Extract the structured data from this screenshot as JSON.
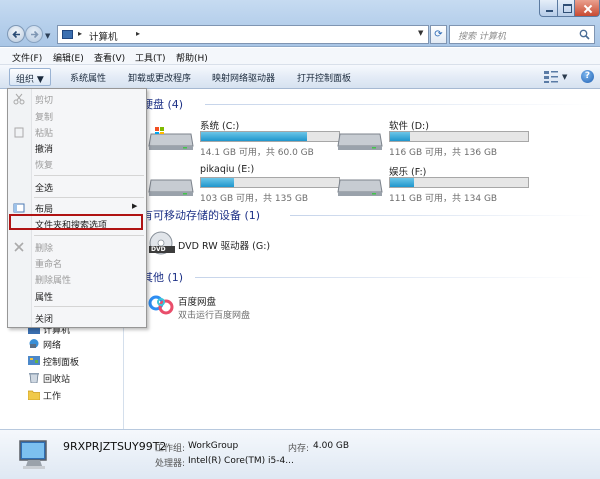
{
  "window": {
    "address": "计算机",
    "search_placeholder": "搜索 计算机"
  },
  "menubar": [
    {
      "label": "文件(F)"
    },
    {
      "label": "编辑(E)"
    },
    {
      "label": "查看(V)"
    },
    {
      "label": "工具(T)"
    },
    {
      "label": "帮助(H)"
    }
  ],
  "toolbar": {
    "organize": "组织 ▼",
    "items": [
      "系统属性",
      "卸载或更改程序",
      "映射网络驱动器",
      "打开控制面板"
    ]
  },
  "context_menu": {
    "items": [
      {
        "label": "剪切",
        "disabled": true,
        "icon": "scissors-icon"
      },
      {
        "label": "复制",
        "disabled": true,
        "icon": "copy-icon"
      },
      {
        "label": "粘贴",
        "disabled": true,
        "icon": "paste-icon"
      },
      {
        "label": "撤消",
        "disabled": false
      },
      {
        "label": "恢复",
        "disabled": true
      },
      {
        "label": "全选",
        "disabled": false
      },
      {
        "label": "布局",
        "disabled": false,
        "icon": "layout-icon",
        "submenu": true
      },
      {
        "label": "文件夹和搜索选项",
        "disabled": false,
        "highlighted": true
      },
      {
        "label": "删除",
        "disabled": true,
        "icon": "delete-icon"
      },
      {
        "label": "重命名",
        "disabled": true
      },
      {
        "label": "删除属性",
        "disabled": true
      },
      {
        "label": "属性",
        "disabled": false
      },
      {
        "label": "关闭",
        "disabled": false
      }
    ]
  },
  "nav_pane": {
    "partial_item": "计算机",
    "items": [
      {
        "label": "网络",
        "icon": "network-icon"
      },
      {
        "label": "控制面板",
        "icon": "control-panel-icon"
      },
      {
        "label": "回收站",
        "icon": "recycle-bin-icon"
      },
      {
        "label": "工作",
        "icon": "folder-icon"
      }
    ]
  },
  "groups": {
    "hard_disks": "硬盘 (4)",
    "removable": "有可移动存储的设备 (1)",
    "other": "其他 (1)"
  },
  "drives": [
    {
      "name": "系统 (C:)",
      "free_text": "14.1 GB 可用，共 60.0 GB",
      "used_fraction": 0.765
    },
    {
      "name": "软件 (D:)",
      "free_text": "116 GB 可用，共 136 GB",
      "used_fraction": 0.147
    },
    {
      "name": "pikaqiu (E:)",
      "free_text": "103 GB 可用，共 135 GB",
      "used_fraction": 0.237
    },
    {
      "name": "娱乐 (F:)",
      "free_text": "111 GB 可用，共 134 GB",
      "used_fraction": 0.172
    }
  ],
  "dvd": {
    "name": "DVD RW 驱动器 (G:)",
    "badge": "DVD"
  },
  "other_item": {
    "name": "百度网盘",
    "subtitle": "双击运行百度网盘"
  },
  "details": {
    "computer_name": "9RXPRJZTSUY99T2",
    "workgroup_label": "工作组:",
    "workgroup_value": "WorkGroup",
    "memory_label": "内存:",
    "memory_value": "4.00 GB",
    "cpu_label": "处理器:",
    "cpu_value": "Intel(R) Core(TM) i5-4..."
  },
  "colors": {
    "accent": "#1e3287",
    "bar_fill": "#1f96cc",
    "highlight_border": "#b01313"
  }
}
